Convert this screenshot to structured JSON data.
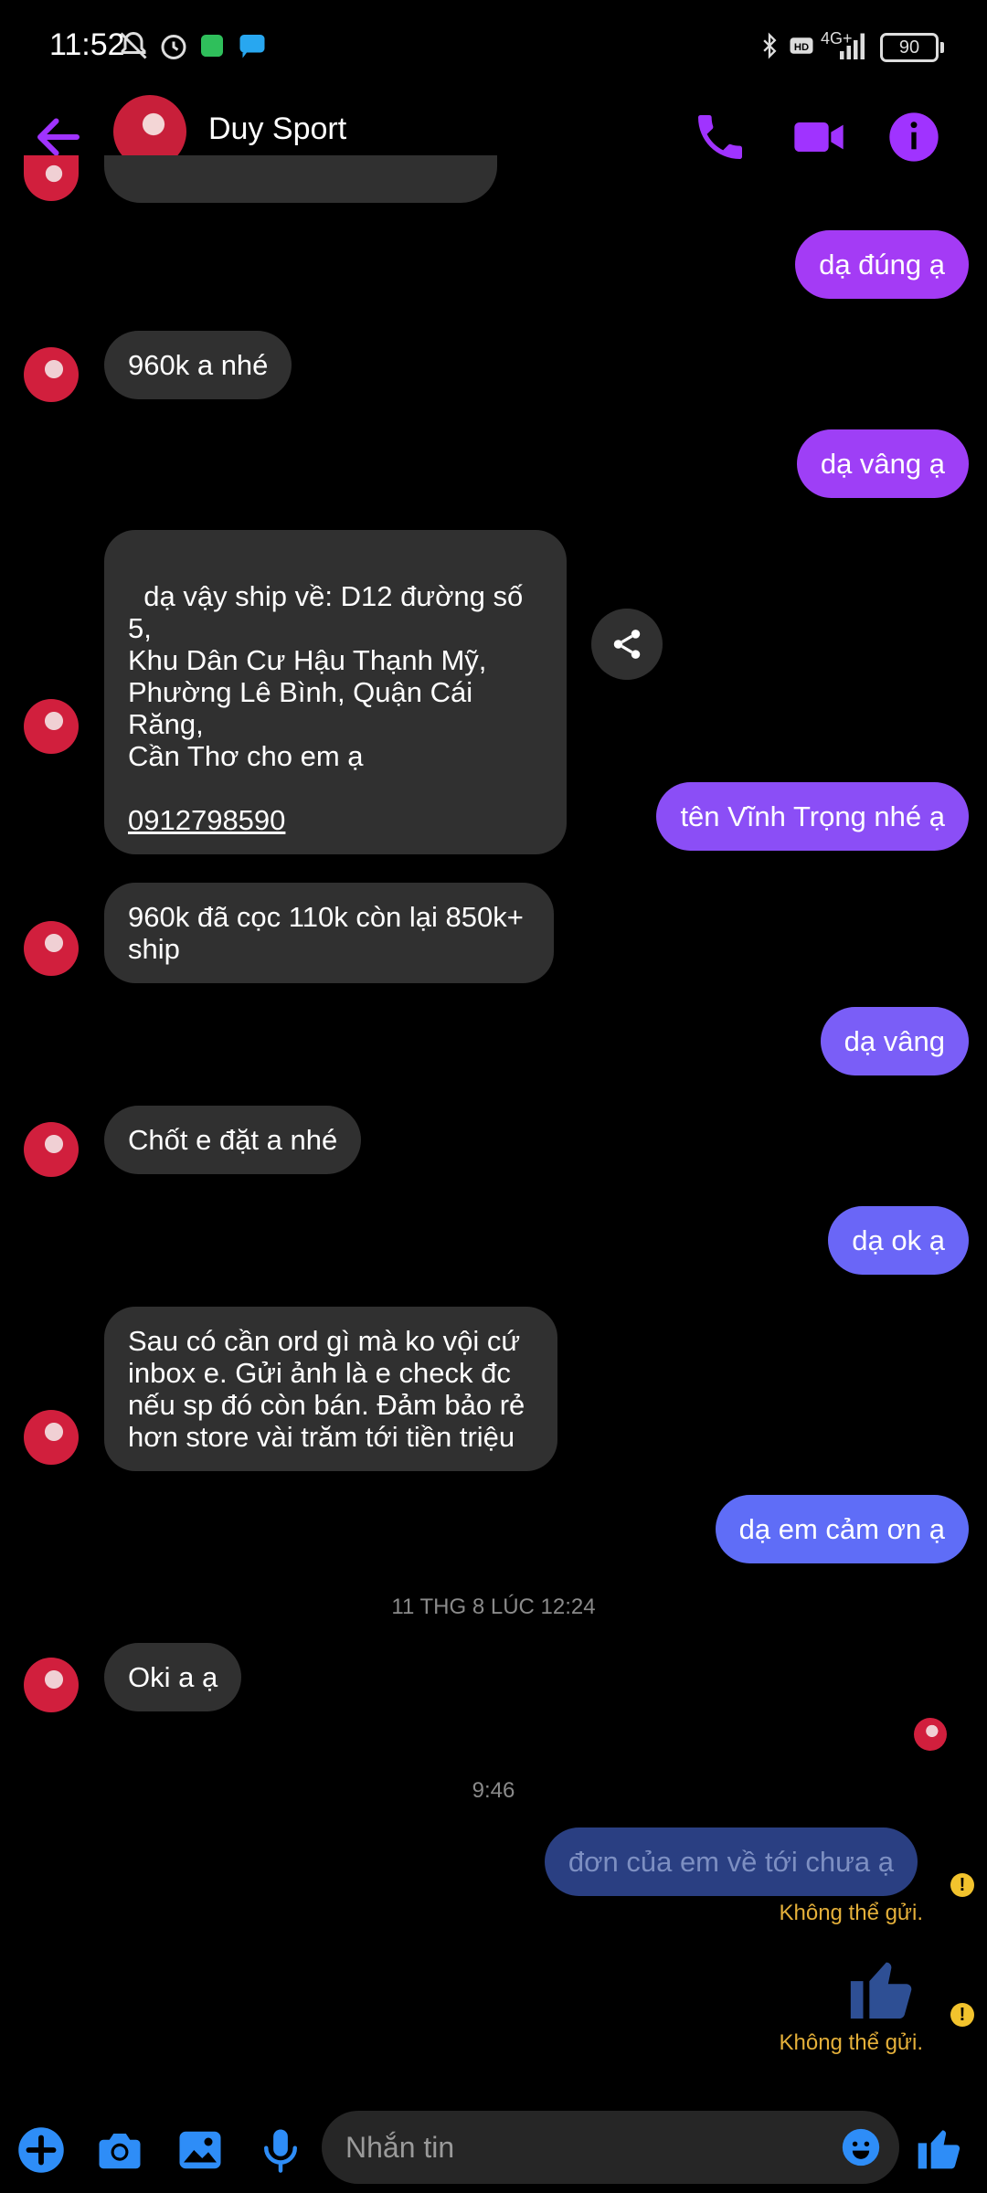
{
  "status": {
    "time": "11:52",
    "network": "4G+",
    "battery": "90"
  },
  "header": {
    "title": "Duy Sport"
  },
  "messages": {
    "m1": "dạ đúng ạ",
    "m2": "960k a nhé",
    "m3": "dạ vâng ạ",
    "m4_text": "dạ vậy ship về: D12 đường số 5,\nKhu Dân Cư Hậu Thạnh Mỹ,\nPhường Lê Bình, Quận Cái Răng,\nCần Thơ cho em ạ",
    "m4_phone": "0912798590",
    "m5": "tên Vĩnh Trọng nhé ạ",
    "m6": "960k đã cọc 110k còn lại 850k+\nship",
    "m7": "dạ vâng",
    "m8": "Chốt e đặt a nhé",
    "m9": "dạ ok ạ",
    "m10": "Sau có cần ord gì mà ko vội cứ\ninbox e. Gửi ảnh là e check đc\nnếu sp đó còn bán. Đảm bảo rẻ\nhơn store vài trăm tới tiền triệu",
    "m11": "dạ em cảm ơn ạ",
    "ts1": "11 THG 8 LÚC 12:24",
    "m12": "Oki a ạ",
    "ts2": "9:46",
    "m13": "đơn của em về tới chưa ạ",
    "fail1": "Không thể gửi.",
    "fail2": "Không thể gửi."
  },
  "composer": {
    "placeholder": "Nhắn tin"
  },
  "colors": {
    "accent": "#a033ff",
    "bubble_in": "#303030",
    "bubble_out_top": "#a43bf5",
    "bubble_out_bottom": "#5f6df7",
    "failed_bubble": "#2a3f82",
    "warning": "#f2c32d"
  },
  "icons": [
    "back-arrow-icon",
    "phone-icon",
    "video-call-icon",
    "info-icon",
    "share-icon",
    "plus-icon",
    "camera-icon",
    "image-icon",
    "microphone-icon",
    "emoji-icon",
    "thumbs-up-icon"
  ]
}
